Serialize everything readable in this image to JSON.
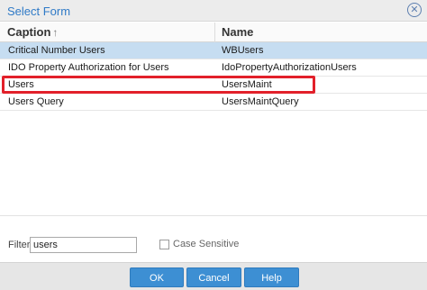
{
  "dialog": {
    "title": "Select Form",
    "close_icon": "close-circle-icon"
  },
  "grid": {
    "columns": [
      {
        "label": "Caption",
        "sort": "↑"
      },
      {
        "label": "Name"
      }
    ],
    "rows": [
      {
        "caption": "Critical Number Users",
        "name": "WBUsers",
        "selected": true
      },
      {
        "caption": "IDO Property Authorization for Users",
        "name": "IdoPropertyAuthorizationUsers",
        "selected": false
      },
      {
        "caption": "Users",
        "name": "UsersMaint",
        "selected": false,
        "highlighted": true
      },
      {
        "caption": "Users Query",
        "name": "UsersMaintQuery",
        "selected": false
      }
    ]
  },
  "filter": {
    "label": "Filter:",
    "value": "users",
    "case_sensitive_label": "Case Sensitive",
    "case_sensitive_checked": false
  },
  "buttons": {
    "ok": "OK",
    "cancel": "Cancel",
    "help": "Help"
  },
  "colors": {
    "accent": "#3d8fd3",
    "title": "#2f7ac7",
    "selected_row": "#c6ddf1",
    "highlight_box": "#e2202a"
  }
}
